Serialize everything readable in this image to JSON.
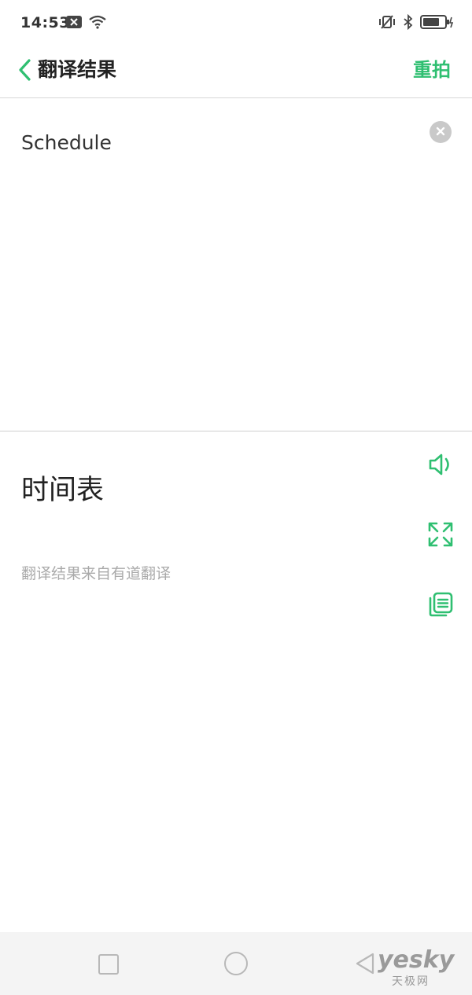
{
  "status_bar": {
    "time": "14:53",
    "left_icons": [
      "notification-x-icon",
      "wifi-icon"
    ],
    "right_icons": [
      "vibrate-icon",
      "bluetooth-icon",
      "battery-icon"
    ]
  },
  "header": {
    "title": "翻译结果",
    "retake_label": "重拍"
  },
  "source": {
    "text": "Schedule"
  },
  "result": {
    "text": "时间表",
    "attribution": "翻译结果来自有道翻译"
  },
  "actions": [
    "speaker-icon",
    "fullscreen-icon",
    "copy-icon"
  ],
  "nav_bar": [
    "recent-apps-button",
    "home-button",
    "back-button"
  ],
  "watermark": {
    "logo_text": "yesky",
    "sub_text": "天极网"
  },
  "colors": {
    "accent": "#2fbf71",
    "divider": "#cfcfcf",
    "muted_text": "#aaaaaa"
  }
}
